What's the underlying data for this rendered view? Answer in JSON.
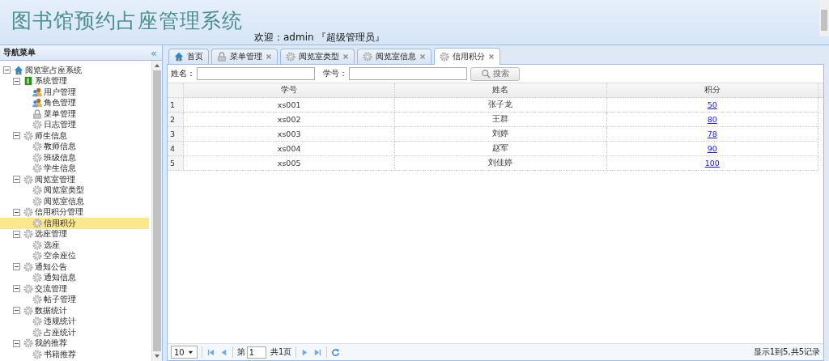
{
  "header": {
    "title": "图书馆预约占座管理系统",
    "welcome": "欢迎：admin 『超级管理员』"
  },
  "sidebar": {
    "title": "导航菜单",
    "collapse": "«",
    "tree": [
      {
        "label": "阅览室占座系统",
        "kind": "home",
        "expanded": true,
        "selected": false,
        "children": [
          {
            "label": "系统管理",
            "kind": "folder",
            "expanded": true,
            "selected": false,
            "children": [
              {
                "label": "用户管理",
                "kind": "users",
                "selected": false
              },
              {
                "label": "角色管理",
                "kind": "users",
                "selected": false
              },
              {
                "label": "菜单管理",
                "kind": "lock",
                "selected": false
              },
              {
                "label": "日志管理",
                "kind": "gear",
                "selected": false
              }
            ]
          },
          {
            "label": "师生信息",
            "kind": "gear",
            "expanded": true,
            "selected": false,
            "children": [
              {
                "label": "教师信息",
                "kind": "gear",
                "selected": false
              },
              {
                "label": "班级信息",
                "kind": "gear",
                "selected": false
              },
              {
                "label": "学生信息",
                "kind": "gear",
                "selected": false
              }
            ]
          },
          {
            "label": "阅览室管理",
            "kind": "gear",
            "expanded": true,
            "selected": false,
            "children": [
              {
                "label": "阅览室类型",
                "kind": "gear",
                "selected": false
              },
              {
                "label": "阅览室信息",
                "kind": "gear",
                "selected": false
              }
            ]
          },
          {
            "label": "信用积分管理",
            "kind": "gear",
            "expanded": true,
            "selected": false,
            "children": [
              {
                "label": "信用积分",
                "kind": "gear",
                "selected": true
              }
            ]
          },
          {
            "label": "选座管理",
            "kind": "gear",
            "expanded": true,
            "selected": false,
            "children": [
              {
                "label": "选座",
                "kind": "gear",
                "selected": false
              },
              {
                "label": "空余座位",
                "kind": "gear",
                "selected": false
              }
            ]
          },
          {
            "label": "通知公告",
            "kind": "gear",
            "expanded": true,
            "selected": false,
            "children": [
              {
                "label": "通知信息",
                "kind": "gear",
                "selected": false
              }
            ]
          },
          {
            "label": "交流管理",
            "kind": "gear",
            "expanded": true,
            "selected": false,
            "children": [
              {
                "label": "帖子管理",
                "kind": "gear",
                "selected": false
              }
            ]
          },
          {
            "label": "数据统计",
            "kind": "gear",
            "expanded": true,
            "selected": false,
            "children": [
              {
                "label": "违规统计",
                "kind": "gear",
                "selected": false
              },
              {
                "label": "占座统计",
                "kind": "gear",
                "selected": false
              }
            ]
          },
          {
            "label": "我的推荐",
            "kind": "gear",
            "expanded": true,
            "selected": false,
            "children": [
              {
                "label": "书籍推荐",
                "kind": "gear",
                "selected": false
              }
            ]
          }
        ]
      }
    ]
  },
  "tabs": [
    {
      "label": "首页",
      "kind": "home",
      "closable": false,
      "selected": false
    },
    {
      "label": "菜单管理",
      "kind": "lock",
      "closable": true,
      "selected": false
    },
    {
      "label": "阅览室类型",
      "kind": "gear",
      "closable": true,
      "selected": false
    },
    {
      "label": "阅览室信息",
      "kind": "gear",
      "closable": true,
      "selected": false
    },
    {
      "label": "信用积分",
      "kind": "gear",
      "closable": true,
      "selected": true
    }
  ],
  "search": {
    "name_label": "姓名：",
    "id_label": "学号：",
    "button": "搜索"
  },
  "table": {
    "columns": [
      "学号",
      "姓名",
      "积分"
    ],
    "rows": [
      {
        "index": "1",
        "id": "xs001",
        "name": "张子龙",
        "score": "50"
      },
      {
        "index": "2",
        "id": "xs002",
        "name": "王群",
        "score": "80"
      },
      {
        "index": "3",
        "id": "xs003",
        "name": "刘婷",
        "score": "78"
      },
      {
        "index": "4",
        "id": "xs004",
        "name": "赵军",
        "score": "90"
      },
      {
        "index": "5",
        "id": "xs005",
        "name": "刘佳婷",
        "score": "100"
      }
    ]
  },
  "pager": {
    "page_size": "10",
    "page_prefix": "第",
    "page": "1",
    "page_total": "共1页",
    "summary": "显示1到5,共5记录"
  }
}
